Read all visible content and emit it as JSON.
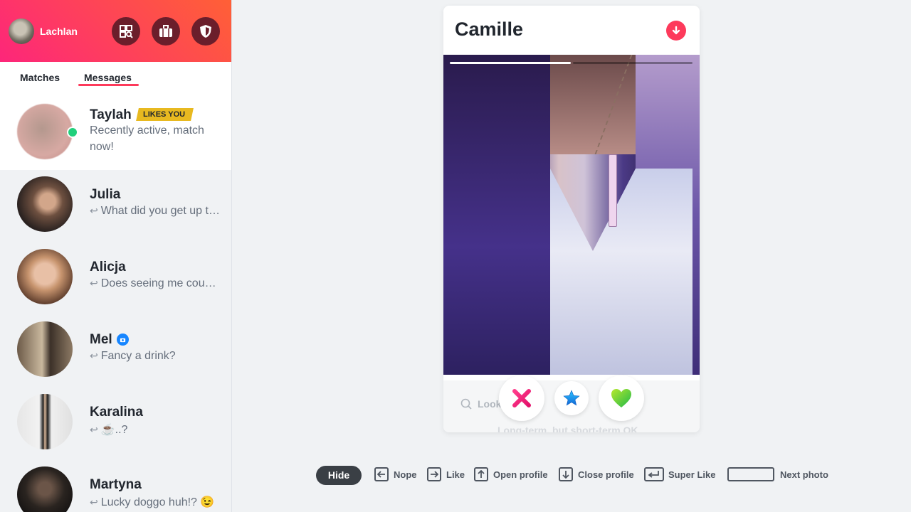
{
  "sidebar": {
    "user_name": "Lachlan",
    "top_buttons": [
      "explore-icon",
      "briefcase-icon",
      "shield-icon"
    ],
    "tabs": [
      {
        "label": "Matches",
        "active": false
      },
      {
        "label": "Messages",
        "active": true
      }
    ],
    "conversations": [
      {
        "name": "Taylah",
        "badge": "LIKES YOU",
        "message": "Recently active, match now!",
        "online": true,
        "blurred": true
      },
      {
        "name": "Julia",
        "message": "What did you get up to today?",
        "reply": true
      },
      {
        "name": "Alicja",
        "message": "Does seeing me count as a drink?",
        "reply": true
      },
      {
        "name": "Mel",
        "message": "Fancy a drink?",
        "reply": true,
        "verified": true
      },
      {
        "name": "Karalina",
        "message": "☕..?",
        "reply": true
      },
      {
        "name": "Martyna",
        "message": "Lucky doggo huh!? 😉",
        "reply": true
      }
    ]
  },
  "card": {
    "name": "Camille",
    "photo_index": 1,
    "photo_count": 2,
    "looking_for_label": "Looking for",
    "looking_for_value": "Long-term, but short-term OK"
  },
  "actions": [
    "nope-icon",
    "super-like-icon",
    "like-icon"
  ],
  "shortcuts": {
    "hide": "Hide",
    "items": [
      {
        "key": "left-arrow-icon",
        "label": "Nope"
      },
      {
        "key": "right-arrow-icon",
        "label": "Like"
      },
      {
        "key": "up-arrow-icon",
        "label": "Open profile"
      },
      {
        "key": "down-arrow-icon",
        "label": "Close profile"
      },
      {
        "key": "enter-icon",
        "label": "Super Like"
      },
      {
        "key": "spacebar-icon",
        "label": "Next photo"
      }
    ]
  },
  "colors": {
    "brand_gradient_start": "#fd267a",
    "brand_gradient_end": "#ff6036",
    "accent": "#fd3a5b",
    "online": "#21d07c",
    "likes_badge": "#e8b920"
  }
}
